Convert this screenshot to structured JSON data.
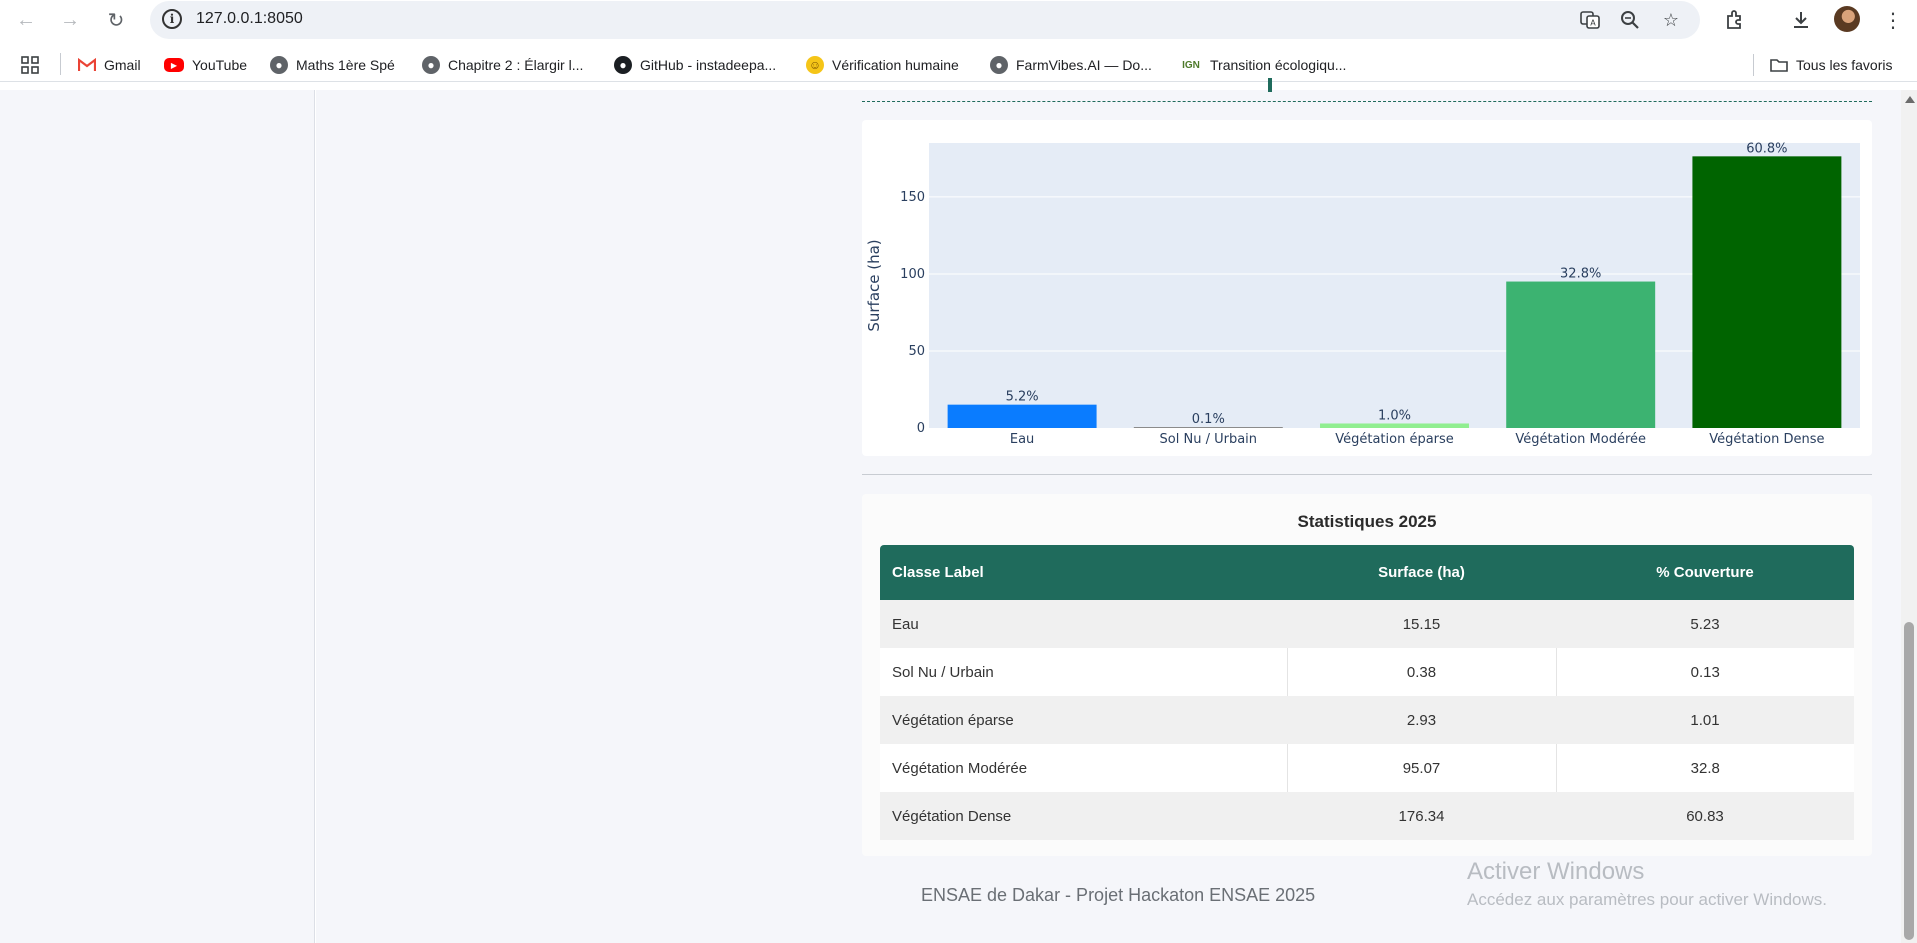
{
  "browser": {
    "url": "127.0.0.1:8050",
    "bookmarks": [
      {
        "label": "Gmail",
        "icon": "gmail-icon"
      },
      {
        "label": "YouTube",
        "icon": "youtube-icon"
      },
      {
        "label": "Maths 1ère Spé",
        "icon": "globe-icon"
      },
      {
        "label": "Chapitre 2 : Élargir l...",
        "icon": "globe-icon"
      },
      {
        "label": "GitHub - instadeepa...",
        "icon": "github-icon"
      },
      {
        "label": "Vérification humaine",
        "icon": "emoji-icon"
      },
      {
        "label": "FarmVibes.AI — Do...",
        "icon": "globe-icon"
      },
      {
        "label": "Transition écologiqu...",
        "icon": "ign-icon"
      }
    ],
    "ign_badge": "IGN",
    "all_bookmarks_label": "Tous les favoris"
  },
  "chart_data": {
    "type": "bar",
    "categories": [
      "Eau",
      "Sol Nu / Urbain",
      "Végétation éparse",
      "Végétation Modérée",
      "Végétation Dense"
    ],
    "values": [
      15.15,
      0.38,
      2.93,
      95.07,
      176.34
    ],
    "data_labels": [
      "5.2%",
      "0.1%",
      "1.0%",
      "32.8%",
      "60.8%"
    ],
    "colors": [
      "#0a7cff",
      "#8b8b8b",
      "#90ee90",
      "#3cb371",
      "#006400"
    ],
    "ylabel": "Surface (ha)",
    "xlabel": "",
    "yticks": [
      0,
      50,
      100,
      150
    ],
    "ylim": [
      0,
      185
    ],
    "grid": true,
    "plot_bg": "#e5ecf6"
  },
  "stats": {
    "title": "Statistiques 2025",
    "headers": [
      "Classe Label",
      "Surface (ha)",
      "% Couverture"
    ],
    "rows": [
      [
        "Eau",
        "15.15",
        "5.23"
      ],
      [
        "Sol Nu / Urbain",
        "0.38",
        "0.13"
      ],
      [
        "Végétation éparse",
        "2.93",
        "1.01"
      ],
      [
        "Végétation Modérée",
        "95.07",
        "32.8"
      ],
      [
        "Végétation Dense",
        "176.34",
        "60.83"
      ]
    ],
    "header_color": "#1f6b5c"
  },
  "footer": "ENSAE de Dakar - Projet Hackaton ENSAE 2025",
  "watermark": {
    "title": "Activer Windows",
    "subtitle": "Accédez aux paramètres pour activer Windows."
  }
}
